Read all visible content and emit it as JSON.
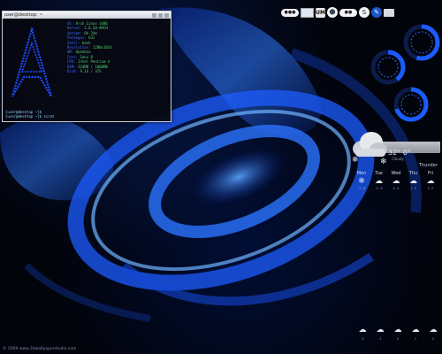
{
  "terminal": {
    "title": "user@desktop: ~",
    "info_lines": [
      {
        "label": "OS:",
        "value": "Arch Linux i686"
      },
      {
        "label": "Kernel:",
        "value": "2.6.28-ARCH"
      },
      {
        "label": "Uptime:",
        "value": "0h 24m"
      },
      {
        "label": "Packages:",
        "value": "632"
      },
      {
        "label": "Shell:",
        "value": "bash"
      },
      {
        "label": "Resolution:",
        "value": "1280x1024"
      },
      {
        "label": "WM:",
        "value": "Openbox"
      },
      {
        "label": "Font:",
        "value": "Sans 8"
      },
      {
        "label": "CPU:",
        "value": "Intel Pentium 4"
      },
      {
        "label": "RAM:",
        "value": "324MB / 1008MB"
      },
      {
        "label": "Disk:",
        "value": "9.1G / 37G"
      }
    ],
    "prompt_lines": [
      "[user@desktop ~]$ ",
      "[user@desktop ~]$ scrot"
    ]
  },
  "tray": {
    "items": [
      {
        "name": "network-indicator",
        "text": "●●●",
        "icon": "network-icon"
      },
      {
        "name": "screen",
        "text": "",
        "icon": "monitor-icon"
      },
      {
        "name": "um",
        "text": "UM",
        "icon": "um-icon"
      },
      {
        "name": "user",
        "text": "☻",
        "icon": "user-icon"
      },
      {
        "name": "volume",
        "text": "●●",
        "icon": "volume-icon"
      },
      {
        "name": "skype",
        "text": "S",
        "icon": "skype-icon"
      },
      {
        "name": "blue-app",
        "text": "✎",
        "icon": "pen-icon"
      },
      {
        "name": "folder",
        "text": "",
        "icon": "folder-icon"
      }
    ]
  },
  "gauges": [
    {
      "name": "cpu-gauge",
      "value": 0.55
    },
    {
      "name": "ram-gauge",
      "value": 0.4
    },
    {
      "name": "disk-gauge",
      "value": 0.7
    }
  ],
  "weather": {
    "current_temp": "32° 0°",
    "condition": "Cloudy",
    "today_label": "Thunder",
    "forecast": [
      {
        "day": "Mon",
        "icon": "❄",
        "temps": "-2 -6"
      },
      {
        "day": "Tue",
        "icon": "☁",
        "temps": "-1 -5"
      },
      {
        "day": "Wed",
        "icon": "☁",
        "temps": "0 -4"
      },
      {
        "day": "Thu",
        "icon": "☁",
        "temps": "1 -3"
      },
      {
        "day": "Fri",
        "icon": "☁",
        "temps": "2 -2"
      }
    ],
    "bottom_icons": [
      {
        "icon": "☁",
        "temps": "-3"
      },
      {
        "icon": "☁",
        "temps": "-1"
      },
      {
        "icon": "☁",
        "temps": "0"
      },
      {
        "icon": "☁",
        "temps": "1"
      },
      {
        "icon": "☁",
        "temps": "2"
      }
    ]
  },
  "credit": "© 2009 www.3dwallpaperstudio.com",
  "colors": {
    "accent": "#1a5cff",
    "terminal_text": "#56d36c"
  }
}
